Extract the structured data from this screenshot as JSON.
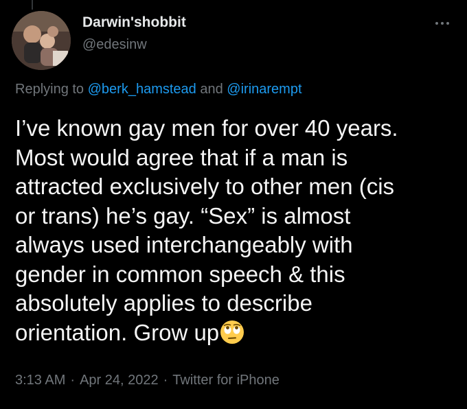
{
  "author": {
    "display_name": "Darwin'shobbit",
    "handle": "@edesinw"
  },
  "reply": {
    "prefix": "Replying to",
    "mention_1": "@berk_hamstead",
    "conjunction": "and",
    "mention_2": "@irinarempt"
  },
  "tweet": {
    "lines": [
      "I’ve known gay men for over 40 years.",
      "Most would agree that if a man is",
      "attracted exclusively to other men (cis",
      "or trans) he’s gay. “Sex” is almost",
      "always used interchangeably with",
      "gender in common speech & this",
      "absolutely applies to describe",
      "orientation. Grow up"
    ],
    "emoji": "face-with-rolling-eyes-emoji"
  },
  "meta": {
    "time": "3:13 AM",
    "separator": "·",
    "date": "Apr 24, 2022",
    "source": "Twitter for iPhone"
  },
  "icons": {
    "more": "more-options-icon"
  },
  "colors": {
    "background": "#000000",
    "primary_text": "#e7e9ea",
    "secondary_text": "#71767b",
    "link": "#1d9bf0"
  }
}
